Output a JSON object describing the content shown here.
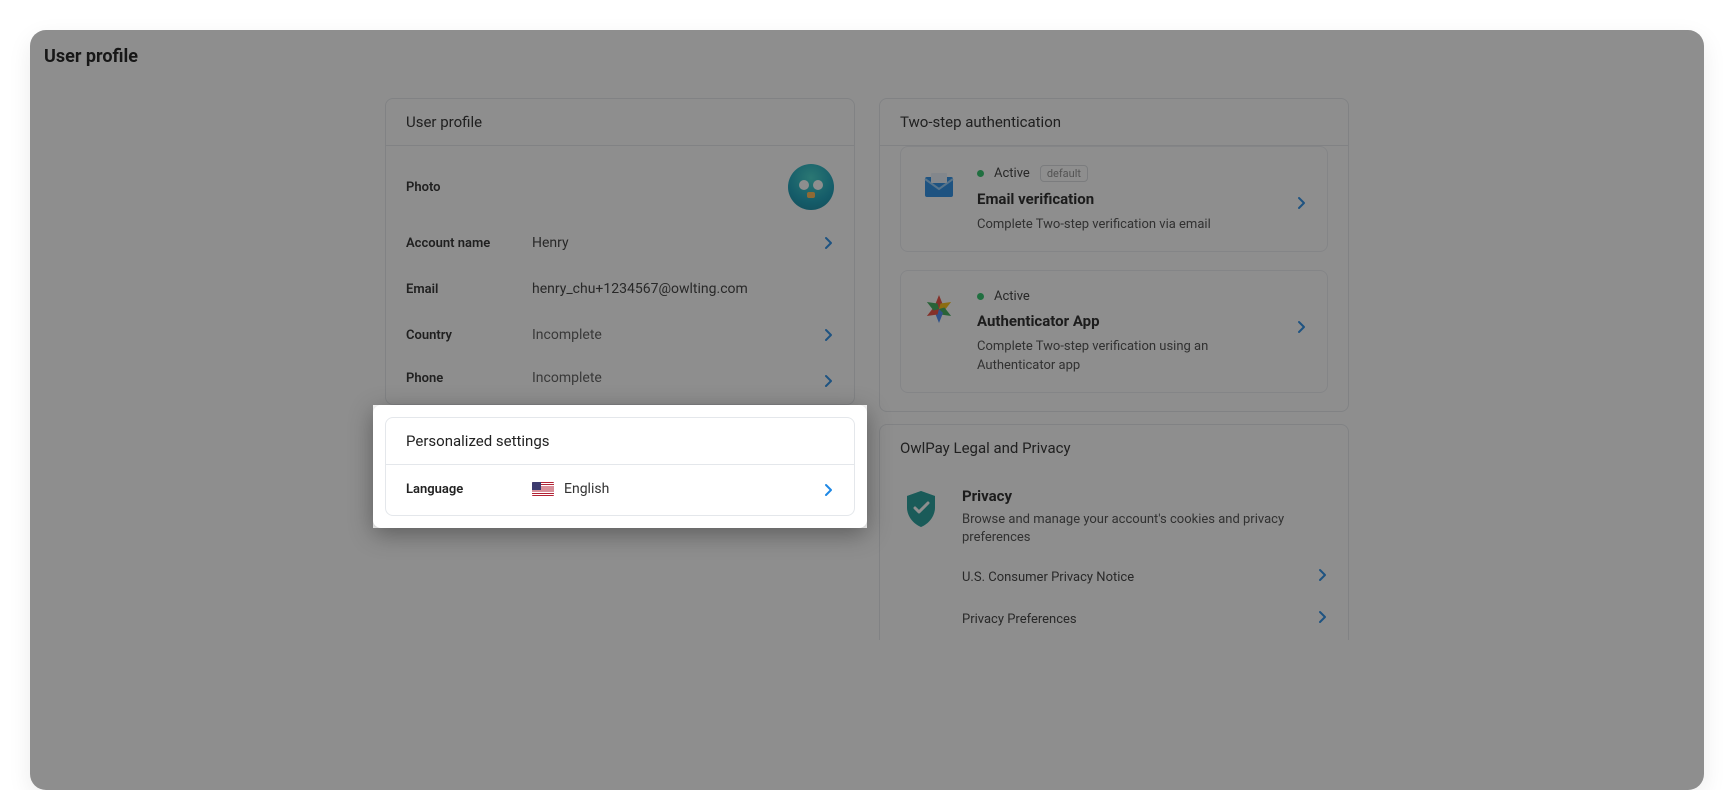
{
  "page_title": "User profile",
  "profile_card": {
    "header": "User profile",
    "photo_label": "Photo",
    "account_name_label": "Account name",
    "account_name_value": "Henry",
    "email_label": "Email",
    "email_value": "henry_chu+1234567@owlting.com",
    "country_label": "Country",
    "country_value": "Incomplete",
    "phone_label": "Phone",
    "phone_value": "Incomplete"
  },
  "personalized_card": {
    "header": "Personalized settings",
    "language_label": "Language",
    "language_value": "English"
  },
  "twofa_card": {
    "header": "Two-step authentication",
    "items": [
      {
        "status": "Active",
        "default_badge": "default",
        "title": "Email verification",
        "desc": "Complete Two-step verification via email"
      },
      {
        "status": "Active",
        "title": "Authenticator App",
        "desc": "Complete Two-step verification using an Authenticator app"
      }
    ]
  },
  "legal_card": {
    "header": "OwlPay Legal and Privacy",
    "privacy_title": "Privacy",
    "privacy_desc": "Browse and manage your account's cookies and privacy preferences",
    "links": [
      "U.S. Consumer Privacy Notice",
      "Privacy Preferences"
    ]
  }
}
